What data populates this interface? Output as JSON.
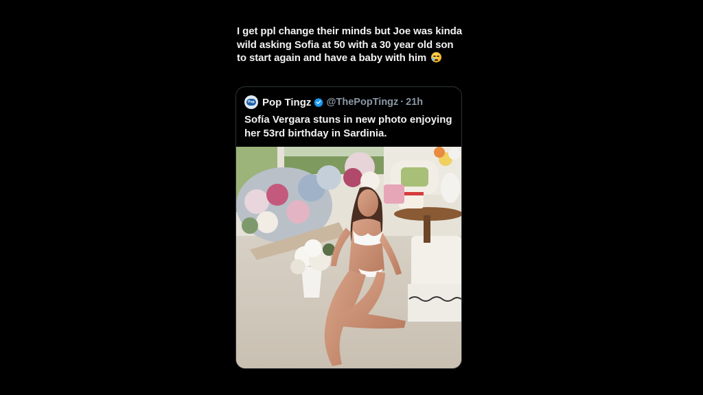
{
  "post": {
    "text": "I get ppl change their minds but Joe was kinda wild asking Sofia at 50 with a 30 year old son to start again and have a baby with him",
    "emoji": "crying-face-icon"
  },
  "quoted_post": {
    "author_name": "Pop Tingz",
    "handle": "@ThePopTingz",
    "separator": "·",
    "time": "21h",
    "avatar_text": "Pop",
    "text": "Sofía Vergara stuns in new photo enjoying her 53rd birthday in Sardinia.",
    "verified_color": "#1d9bf0"
  },
  "colors": {
    "background": "#000000",
    "text": "#f2f2f2",
    "muted": "#8b98a5",
    "border": "#2f3336"
  }
}
